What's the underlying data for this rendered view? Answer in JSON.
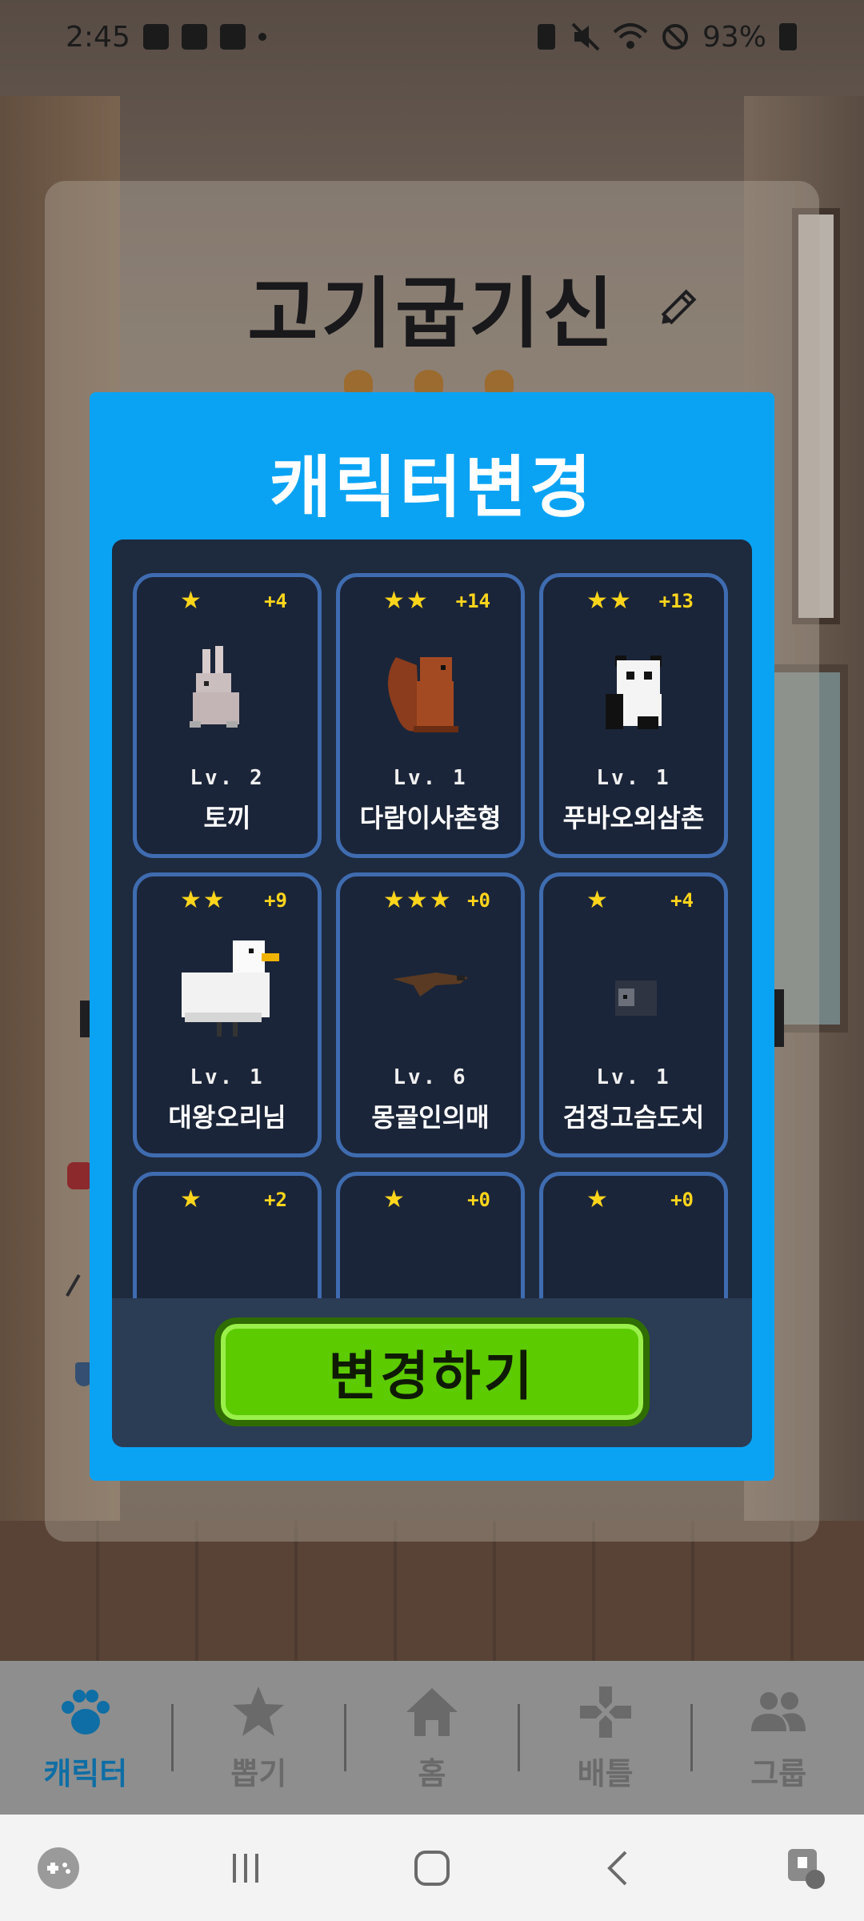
{
  "status_bar": {
    "time": "2:45",
    "battery": "93%"
  },
  "profile": {
    "name": "고기굽기신"
  },
  "modal": {
    "title": "캐릭터변경",
    "button_label": "변경하기",
    "characters": [
      {
        "stars": "★",
        "bonus": "+4",
        "level": "Lv. 2",
        "name": "토끼"
      },
      {
        "stars": "★★",
        "bonus": "+14",
        "level": "Lv. 1",
        "name": "다람이사촌형"
      },
      {
        "stars": "★★",
        "bonus": "+13",
        "level": "Lv. 1",
        "name": "푸바오외삼촌"
      },
      {
        "stars": "★★",
        "bonus": "+9",
        "level": "Lv. 1",
        "name": "대왕오리님"
      },
      {
        "stars": "★★★",
        "bonus": "+0",
        "level": "Lv. 6",
        "name": "몽골인의매"
      },
      {
        "stars": "★",
        "bonus": "+4",
        "level": "Lv. 1",
        "name": "검정고슴도치"
      },
      {
        "stars": "★",
        "bonus": "+2",
        "level": "",
        "name": ""
      },
      {
        "stars": "★",
        "bonus": "+0",
        "level": "",
        "name": ""
      },
      {
        "stars": "★",
        "bonus": "+0",
        "level": "",
        "name": ""
      }
    ]
  },
  "tabs": [
    {
      "label": "캐릭터",
      "icon": "paw-icon",
      "active": true
    },
    {
      "label": "뽑기",
      "icon": "star-icon",
      "active": false
    },
    {
      "label": "홈",
      "icon": "home-icon",
      "active": false
    },
    {
      "label": "배틀",
      "icon": "gamepad-icon",
      "active": false
    },
    {
      "label": "그룹",
      "icon": "group-icon",
      "active": false
    }
  ],
  "colors": {
    "modal_bg": "#0aa3f4",
    "card_border": "#3f6cb0",
    "star": "#ffd51c",
    "button": "#5ccb00",
    "active_tab": "#0e6ea5"
  }
}
